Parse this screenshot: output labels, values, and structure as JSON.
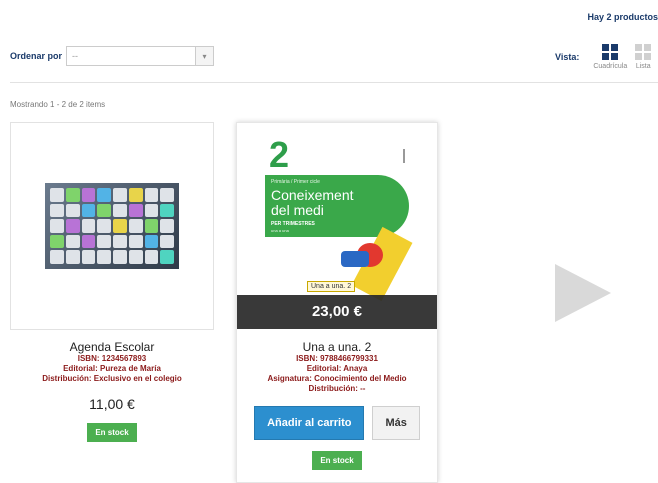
{
  "header": {
    "product_count": "Hay 2 productos"
  },
  "sort": {
    "label": "Ordenar por",
    "value": "--",
    "arrow_glyph": "▾"
  },
  "view": {
    "label": "Vista:",
    "options": [
      {
        "label": "Cuadrícula",
        "active": true
      },
      {
        "label": "Lista",
        "active": false
      }
    ]
  },
  "showing": "Mostrando 1 - 2 de 2 items",
  "products": [
    {
      "title": "Agenda Escolar",
      "isbn": "ISBN: 1234567893",
      "editorial": "Editorial: Pureza de María",
      "distribucion": "Distribución: Exclusivo en el colegio",
      "price": "11,00 €",
      "stock": "En stock",
      "image_icon": "keyboard-image"
    },
    {
      "title": "Una a una. 2",
      "isbn": "ISBN: 9788466799331",
      "editorial": "Editorial: Anaya",
      "asignatura": "Asignatura: Conocimiento del Medio",
      "distribucion": "Distribución: --",
      "price": "23,00 €",
      "add_to_cart": "Añadir al carrito",
      "more": "Más",
      "stock": "En stock",
      "cover": {
        "number": "2",
        "small_text": "Primària / Primer cicle",
        "title_line1": "Coneixement",
        "title_line2": "del medi",
        "subtitle": "PER TRIMESTRES",
        "subtitle2": "una a una",
        "badge": "Una a una. 2"
      }
    }
  ],
  "colors": {
    "brand_blue": "#1a3a6a",
    "meta_red": "#8b1a1a",
    "stock_green": "#4caf50",
    "cart_blue": "#2c8fcf"
  }
}
